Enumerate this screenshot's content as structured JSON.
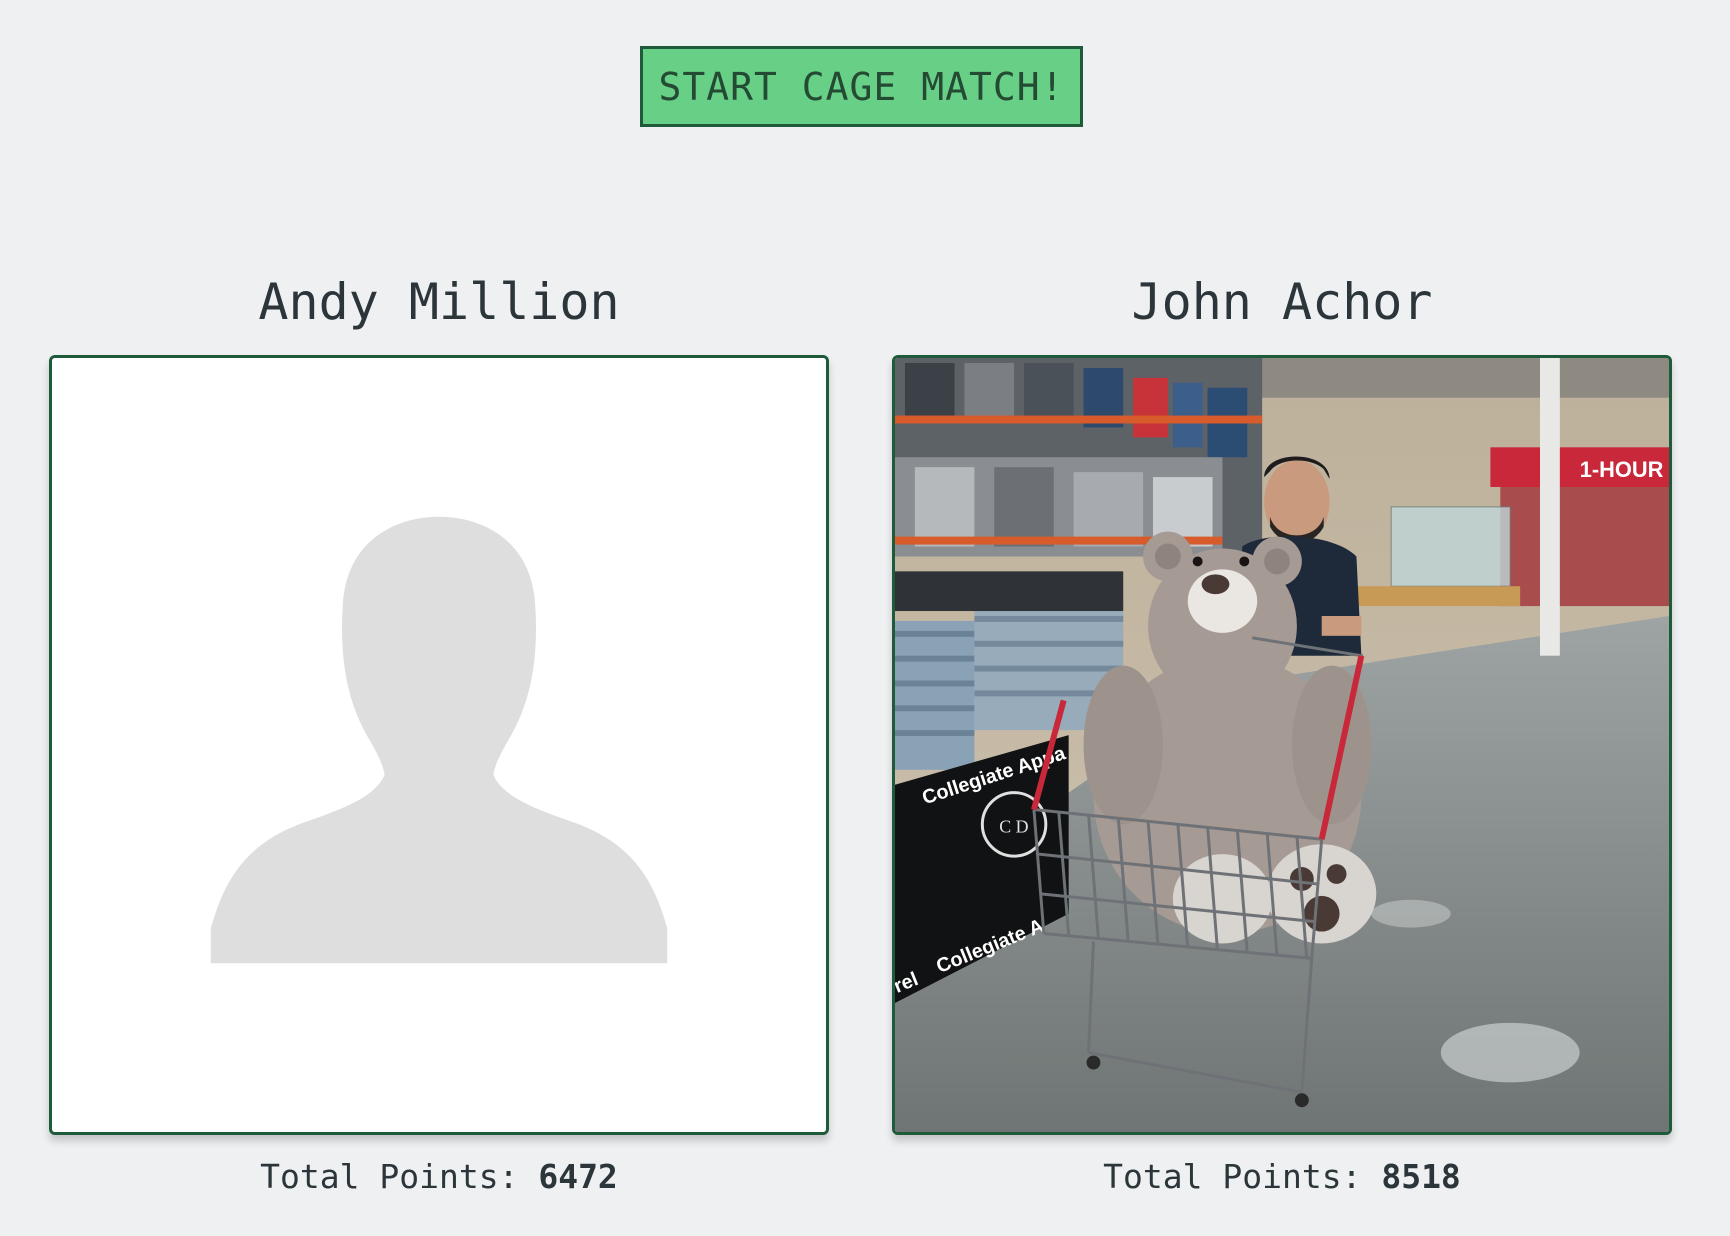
{
  "start_button": {
    "label": "START CAGE MATCH!"
  },
  "players": [
    {
      "name": "Andy Million",
      "photo": "default-avatar-silhouette",
      "points_label": "Total Points:",
      "points": "6472"
    },
    {
      "name": "John Achor",
      "photo": "store-photo-man-with-giant-teddy-bear-in-cart",
      "points_label": "Total Points:",
      "points": "8518",
      "photo_text": {
        "banner_line_1": "Collegiate Appa",
        "banner_line_2": "Collegiate A",
        "banner_fragment": "rel",
        "crest_letters": "C D",
        "store_sign": "1-HOUR"
      }
    }
  ],
  "colors": {
    "page_background": "#eef0f2",
    "button_fill": "#67cf86",
    "border_green": "#1f5a3a",
    "text": "#2c363a"
  }
}
